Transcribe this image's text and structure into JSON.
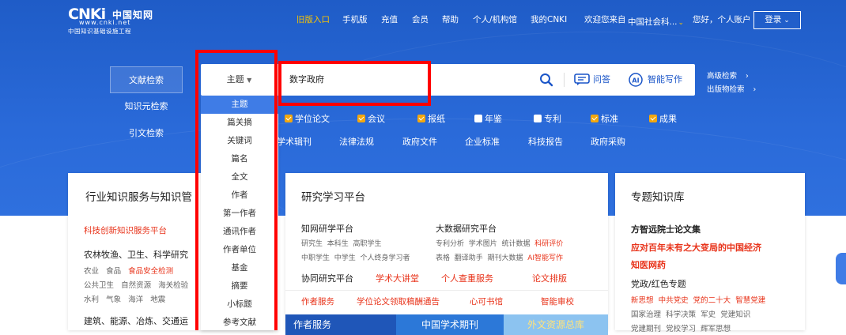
{
  "logo": {
    "main": "CNKi",
    "cn": "中国知网",
    "url": "www.cnki.net",
    "sub": "中国知识基础设施工程"
  },
  "topnav": {
    "old": "旧版入口",
    "mobile": "手机版",
    "recharge": "充值",
    "member": "会员",
    "help": "帮助",
    "personal": "个人/机构馆",
    "mycnki": "我的CNKI",
    "welcome": "欢迎您来自",
    "org": "中国社会科...",
    "hello": "您好，个人账户",
    "login": "登录"
  },
  "side": {
    "lit": "文献检索",
    "knowledge": "知识元检索",
    "cite": "引文检索"
  },
  "search": {
    "field": "主题",
    "query": "数字政府",
    "ask": "问答",
    "ai": "智能写作",
    "adv": "高级检索",
    "pub": "出版物检索"
  },
  "dropdown": [
    "主题",
    "篇关摘",
    "关键词",
    "篇名",
    "全文",
    "作者",
    "第一作者",
    "通讯作者",
    "作者单位",
    "基金",
    "摘要",
    "小标题",
    "参考文献"
  ],
  "checks": [
    {
      "label": "学位论文",
      "on": true
    },
    {
      "label": "会议",
      "on": true
    },
    {
      "label": "报纸",
      "on": true
    },
    {
      "label": "年鉴",
      "on": false
    },
    {
      "label": "专利",
      "on": false
    },
    {
      "label": "标准",
      "on": true
    },
    {
      "label": "成果",
      "on": true
    }
  ],
  "dbs": [
    "学术辑刊",
    "法律法规",
    "政府文件",
    "企业标准",
    "科技报告",
    "政府采购"
  ],
  "card1": {
    "title": "行业知识服务与知识管",
    "platform": "科技创新知识服务平台",
    "sec1": "农林牧渔、卫生、科学研究",
    "row1": [
      "农业",
      "食品",
      "食品安全检测"
    ],
    "row2": [
      "公共卫生",
      "自然资源",
      "海关检验"
    ],
    "row3": [
      "水利",
      "气象",
      "海洋",
      "地震"
    ],
    "sec2": "建筑、能源、冶炼、交通运"
  },
  "card2": {
    "title": "研究学习平台",
    "a": "知网研学平台",
    "a_items": [
      "研究生",
      "本科生",
      "高职学生"
    ],
    "a_items2": [
      "中职学生",
      "中学生",
      "个人终身学习者"
    ],
    "b": "大数据研究平台",
    "b_items": [
      "专利分析",
      "学术图片",
      "统计数据"
    ],
    "b_hot": "科研评价",
    "b_items2": [
      "表格",
      "翻译助手",
      "期刊大数据"
    ],
    "b_hot2": "AI智能写作",
    "c": "协同研究平台",
    "c_items": [
      "学术大讲堂",
      "个人查重服务",
      "论文排版"
    ],
    "d": [
      "作者服务",
      "学位论文领取稿酬通告",
      "心可书馆",
      "智能审校"
    ],
    "banners": [
      "作者服务",
      "中国学术期刊",
      "外文资源总库"
    ]
  },
  "card3": {
    "title": "专题知识库",
    "a": "方智远院士论文集",
    "b": "应对百年未有之大变局的中国经济",
    "c": "知医网药",
    "d": "党政/红色专题",
    "e": [
      "新思想",
      "中共党史",
      "党的二十大",
      "智慧党建"
    ],
    "f": [
      "国家治理",
      "科学决策",
      "军史",
      "党建知识"
    ],
    "g": [
      "党建期刊",
      "党校学习",
      "辉军思想"
    ]
  },
  "colors": {
    "hero": "#2a6ad9",
    "accent": "#3f7ce6",
    "highlight_red": "#ff0000",
    "check_orange": "#f2a70f",
    "nav_active": "#f9c400"
  }
}
